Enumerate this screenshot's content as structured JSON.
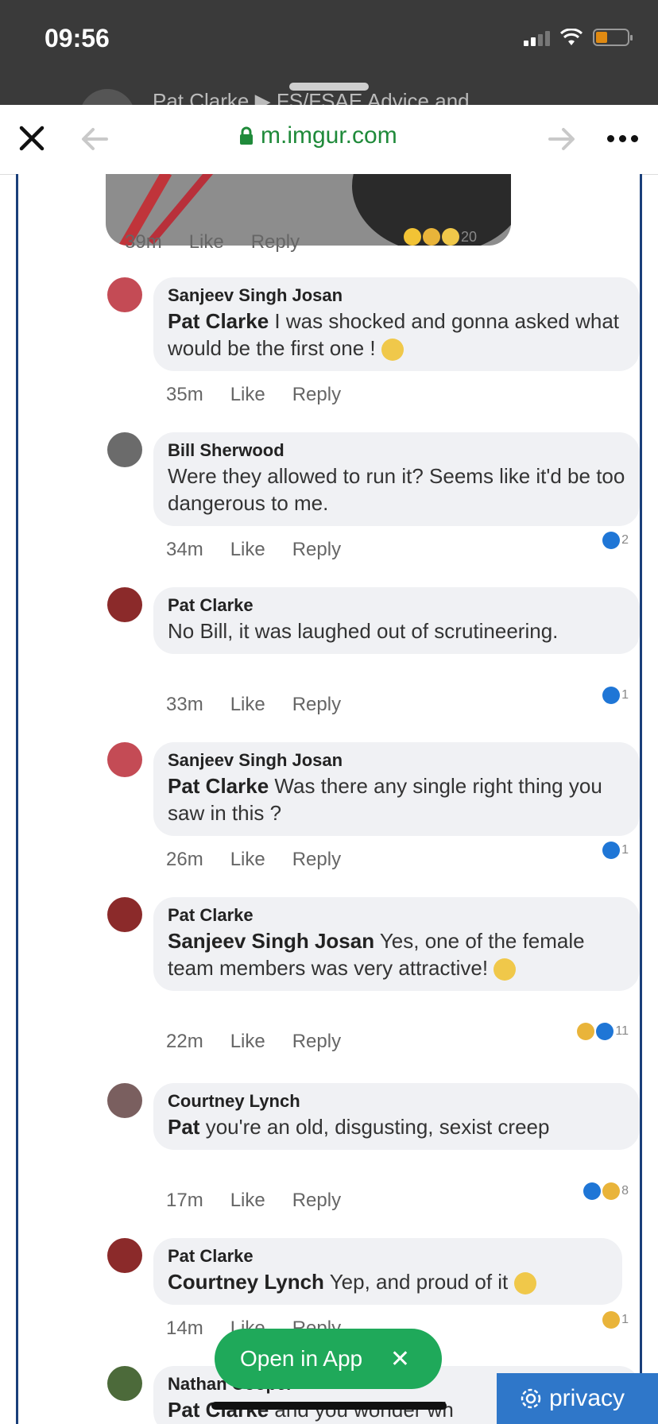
{
  "status_bar": {
    "time": "09:56"
  },
  "background_post": {
    "breadcrumb": "Pat Clarke ▶ FS/FSAE Advice and"
  },
  "browser": {
    "url": "m.imgur.com",
    "close_icon": "close-icon",
    "lock_icon": "lock-icon"
  },
  "post_photo": {
    "time": "39m",
    "like": "Like",
    "reply": "Reply",
    "reaction_count": "20"
  },
  "comments": [
    {
      "name": "Sanjeev Singh Josan",
      "mention": "Pat Clarke",
      "text": " I was shocked and gonna asked what would be the first one !",
      "time": "35m",
      "like": "Like",
      "reply": "Reply",
      "reaction_count": ""
    },
    {
      "name": "Bill Sherwood",
      "mention": "",
      "text": "Were they allowed to run it? Seems like it'd be too dangerous to me.",
      "time": "34m",
      "like": "Like",
      "reply": "Reply",
      "reaction_count": "2"
    },
    {
      "name": "Pat Clarke",
      "mention": "",
      "text": "No Bill, it was laughed out of scrutineering.",
      "time": "33m",
      "like": "Like",
      "reply": "Reply",
      "reaction_count": "1"
    },
    {
      "name": "Sanjeev Singh Josan",
      "mention": "Pat Clarke",
      "text": " Was there any single right thing you saw in this ?",
      "time": "26m",
      "like": "Like",
      "reply": "Reply",
      "reaction_count": "1"
    },
    {
      "name": "Pat Clarke",
      "mention": "Sanjeev Singh Josan",
      "text": " Yes, one of the female team members was very attractive!",
      "time": "22m",
      "like": "Like",
      "reply": "Reply",
      "reaction_count": "11"
    },
    {
      "name": "Courtney Lynch",
      "mention": "Pat",
      "text": " you're an old, disgusting, sexist creep",
      "time": "17m",
      "like": "Like",
      "reply": "Reply",
      "reaction_count": "8"
    },
    {
      "name": "Pat Clarke",
      "mention": "Courtney Lynch",
      "text": " Yep, and proud of it",
      "time": "14m",
      "like": "Like",
      "reply": "Reply",
      "reaction_count": "1"
    },
    {
      "name": "Nathan Cooper",
      "mention": "Pat Clarke",
      "text": " and you wonder wh",
      "time": "",
      "like": "",
      "reply": "",
      "reaction_count": ""
    }
  ],
  "open_in_app": {
    "label": "Open in App",
    "close": "✕"
  },
  "privacy": {
    "label": "privacy"
  },
  "colors": {
    "url_green": "#1f8a3a",
    "open_app_green": "#1fa95a",
    "privacy_blue": "#2f77c9",
    "bubble_gray": "#f0f1f4"
  }
}
